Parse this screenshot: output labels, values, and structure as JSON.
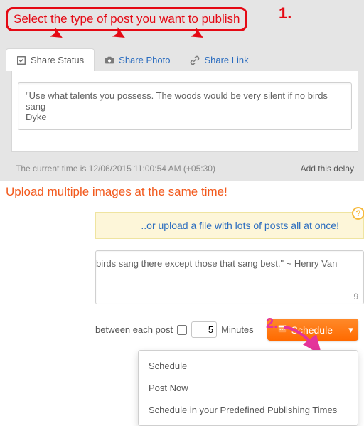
{
  "annotations": {
    "callout_title": "Select the type of post you want to publish",
    "marker1": "1.",
    "marker2": "2."
  },
  "tabs": {
    "status": "Share Status",
    "photo": "Share Photo",
    "link": "Share Link"
  },
  "status_text": "\"Use what talents you possess. The woods would be very silent if no birds sang\nDyke",
  "time_info": "The current time is 12/06/2015 11:00:54 AM (+05:30)",
  "delay_link": "Add this delay",
  "upload_banner": "Upload multiple images at the same time!",
  "file_upload_hint": "..or upload a file with lots of posts all at once!",
  "help_symbol": "?",
  "post_text_fragment": "birds sang there except those that sang best.\" ~ Henry Van",
  "char_count": "9",
  "schedule": {
    "between_fragment": "between each post",
    "interval_value": "5",
    "units": "Minutes",
    "button": "Schedule",
    "menu": {
      "schedule": "Schedule",
      "post_now": "Post Now",
      "predefined": "Schedule in your Predefined Publishing Times"
    }
  }
}
